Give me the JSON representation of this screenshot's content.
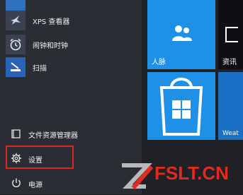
{
  "start_menu": {
    "apps": [
      {
        "label": "XPS 查看器",
        "icon": "xps-viewer-icon"
      },
      {
        "label": "闹钟和时钟",
        "icon": "alarm-clock-icon"
      },
      {
        "label": "扫描",
        "icon": "scanner-icon"
      }
    ],
    "system": {
      "file_explorer": "文件资源管理器",
      "settings": "设置",
      "power": "电源"
    }
  },
  "tiles": {
    "people": "人脉",
    "news": "资讯",
    "store": "",
    "weather": "Weat"
  },
  "watermark": {
    "text": "FSLT.CN"
  },
  "colors": {
    "tile_blue": "#1e90e6",
    "highlight_red": "#e02424",
    "watermark_red": "#e12a20"
  }
}
